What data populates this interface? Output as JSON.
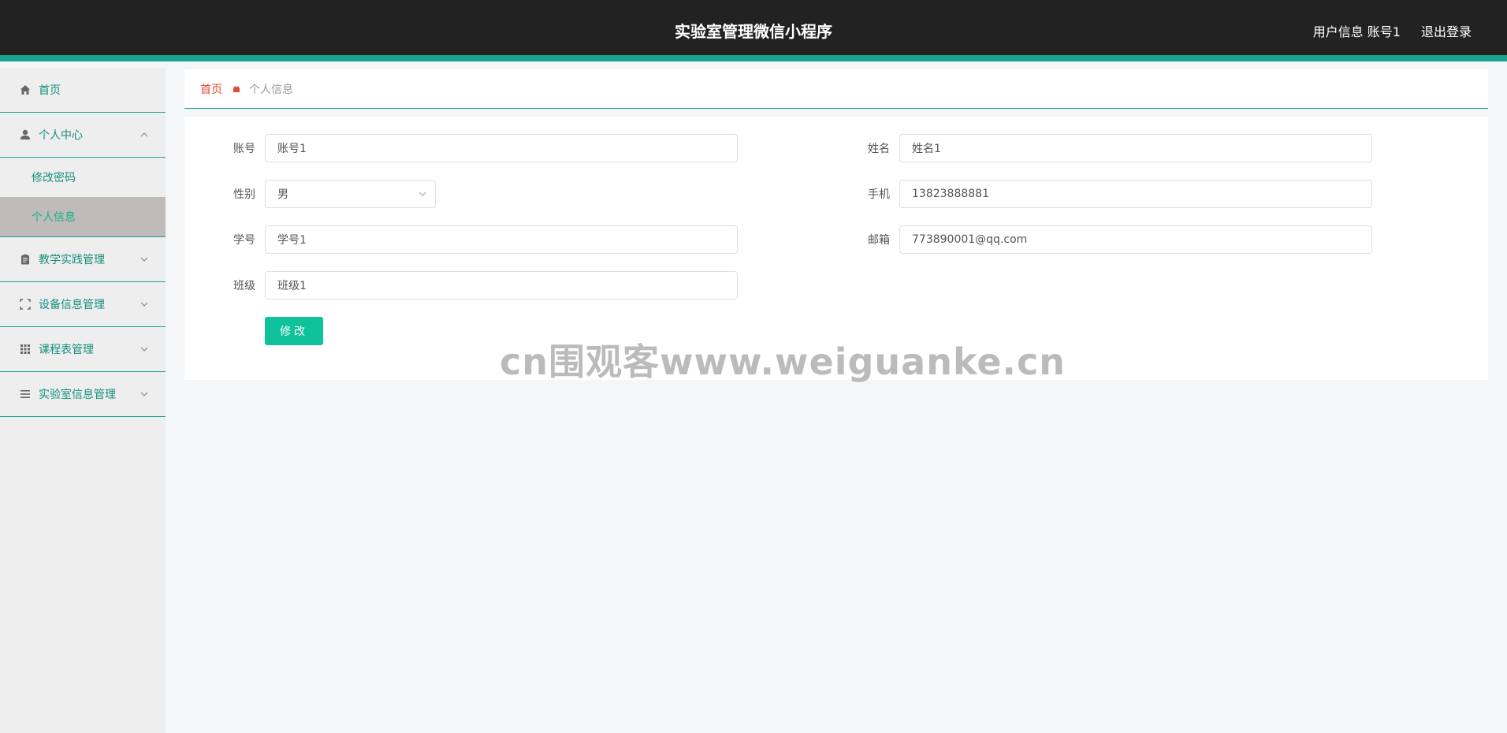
{
  "header": {
    "title": "实验室管理微信小程序",
    "user_info": "用户信息 账号1",
    "logout": "退出登录"
  },
  "sidebar": {
    "items": [
      {
        "label": "首页",
        "icon": "home-icon"
      },
      {
        "label": "个人中心",
        "icon": "user-icon",
        "expanded": true,
        "children": [
          {
            "label": "修改密码"
          },
          {
            "label": "个人信息",
            "active": true
          }
        ]
      },
      {
        "label": "教学实践管理",
        "icon": "clipboard-icon"
      },
      {
        "label": "设备信息管理",
        "icon": "frame-icon"
      },
      {
        "label": "课程表管理",
        "icon": "grid-icon"
      },
      {
        "label": "实验室信息管理",
        "icon": "menu-icon"
      }
    ]
  },
  "breadcrumb": {
    "home": "首页",
    "current": "个人信息"
  },
  "form": {
    "account": {
      "label": "账号",
      "value": "账号1"
    },
    "name": {
      "label": "姓名",
      "value": "姓名1"
    },
    "gender": {
      "label": "性别",
      "value": "男"
    },
    "phone": {
      "label": "手机",
      "value": "13823888881"
    },
    "student_id": {
      "label": "学号",
      "value": "学号1"
    },
    "email": {
      "label": "邮箱",
      "value": "773890001@qq.com"
    },
    "class": {
      "label": "班级",
      "value": "班级1"
    },
    "submit_label": "修改"
  },
  "watermark": "cn围观客www.weiguanke.cn",
  "colors": {
    "accent": "#17a58f",
    "button": "#0fc29b",
    "breadcrumb_home": "#e6483a"
  }
}
